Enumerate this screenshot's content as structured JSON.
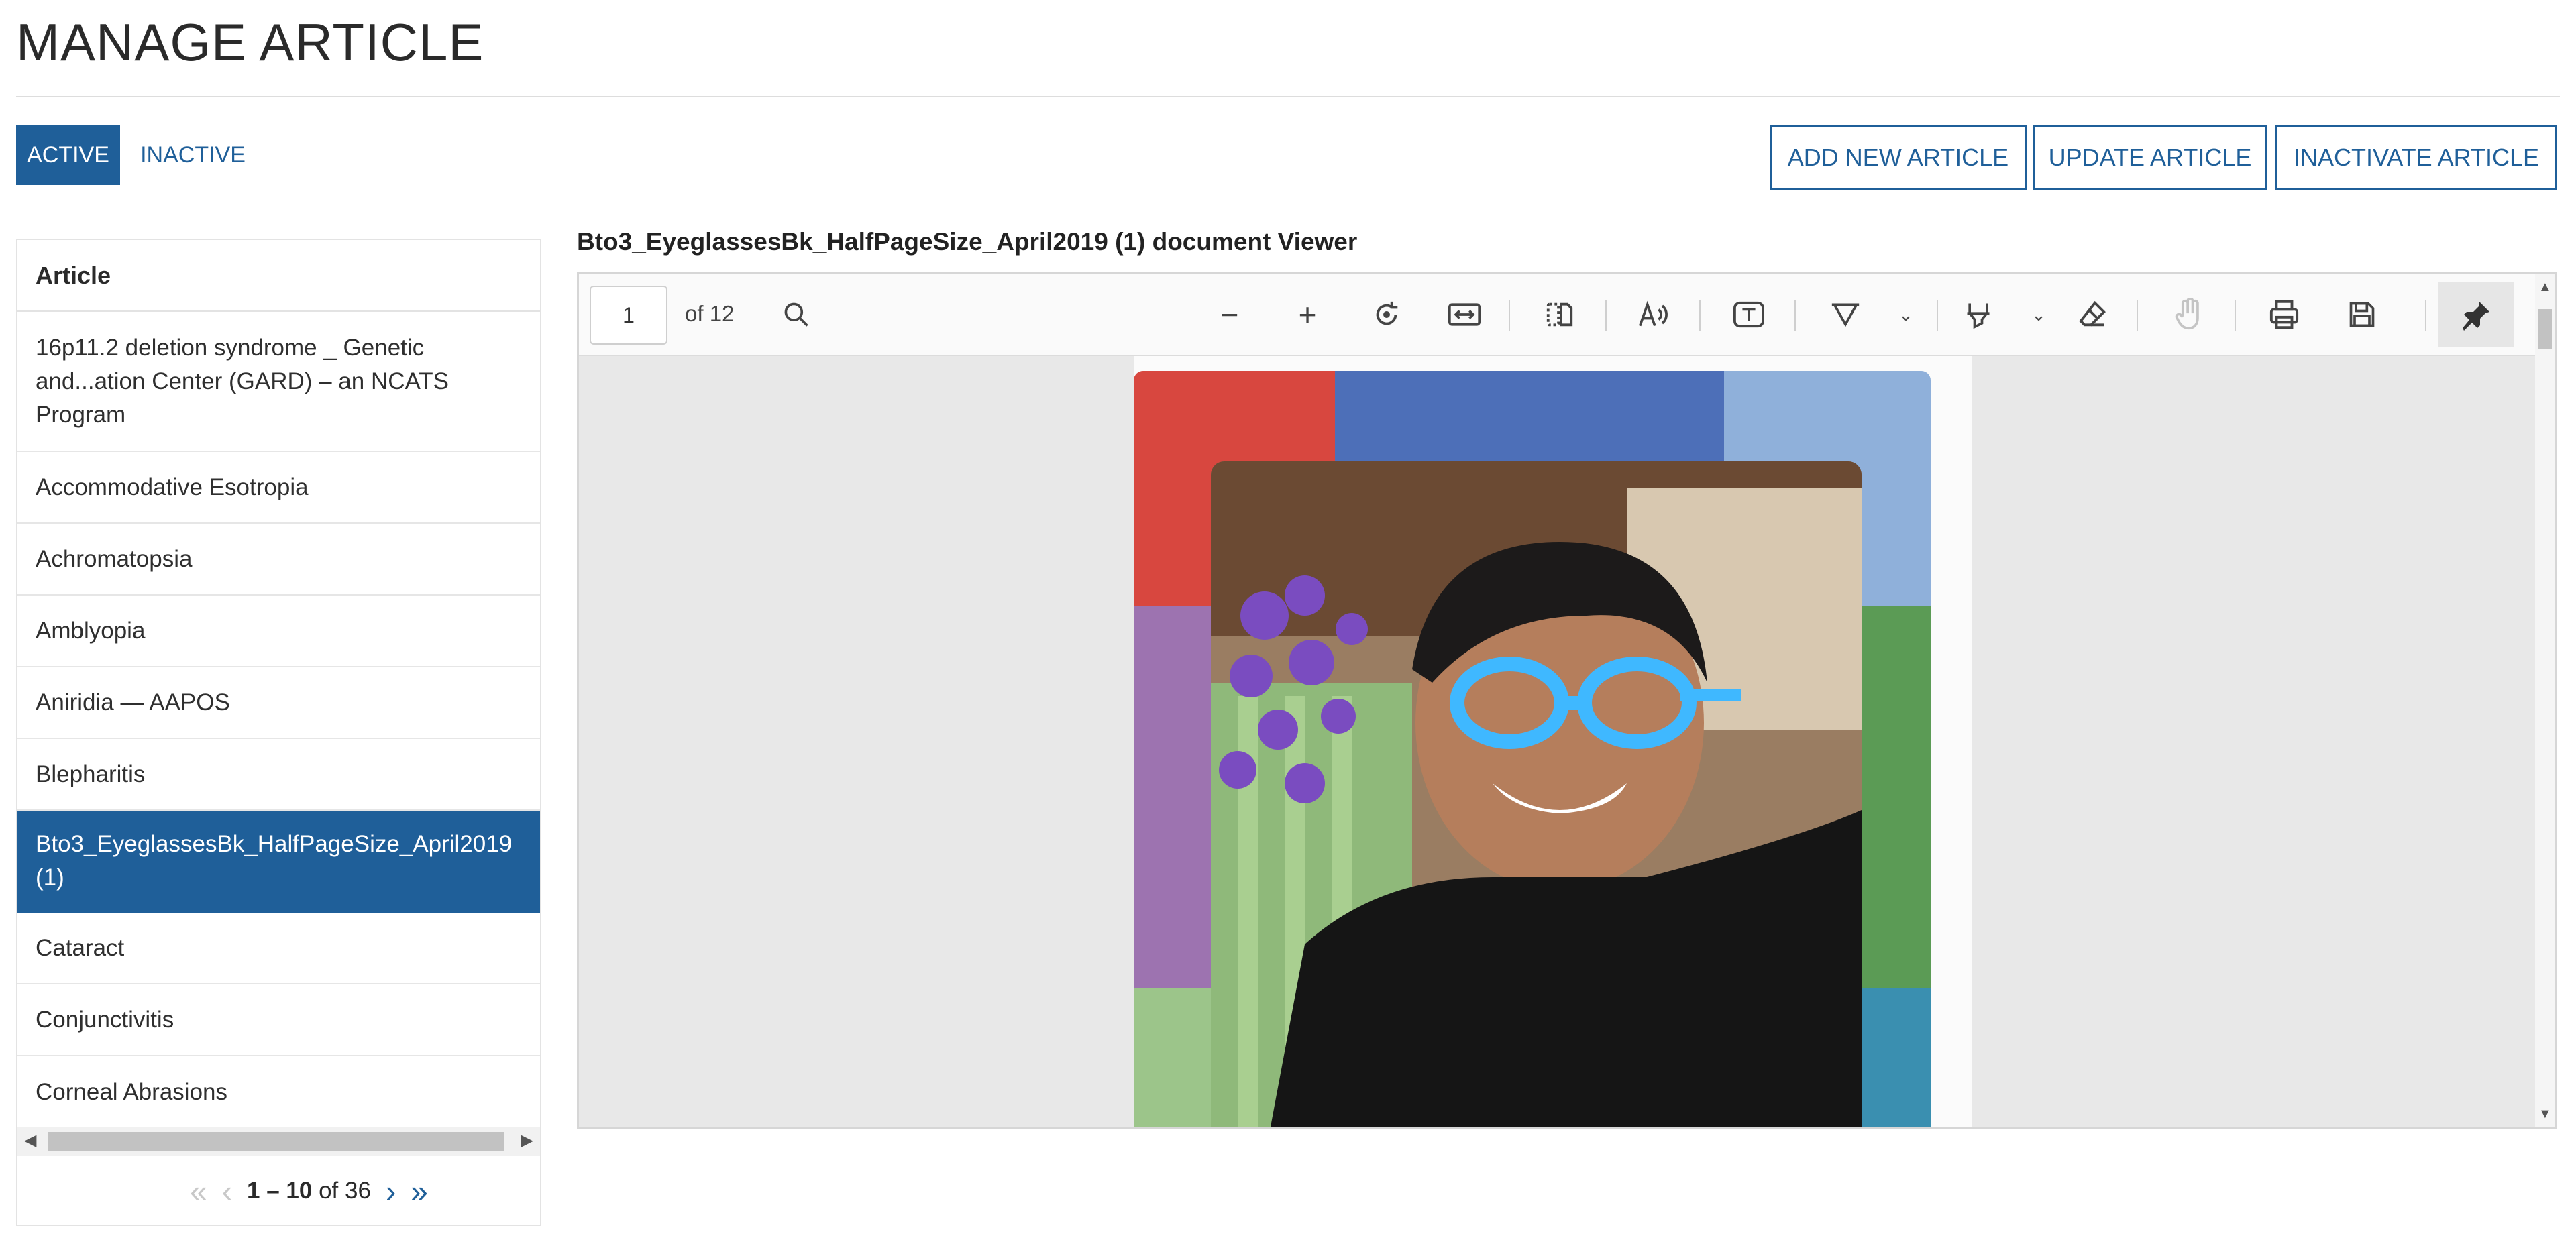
{
  "page": {
    "title": "MANAGE ARTICLE"
  },
  "status_tabs": {
    "active": "ACTIVE",
    "inactive": "INACTIVE"
  },
  "actions": {
    "add": "ADD NEW ARTICLE",
    "update": "UPDATE ARTICLE",
    "inactivate": "INACTIVATE ARTICLE"
  },
  "grid": {
    "header": "Article",
    "rows": [
      {
        "label": "16p11.2 deletion syndrome _ Genetic and...ation Center (GARD) – an NCATS Program"
      },
      {
        "label": "Accommodative Esotropia"
      },
      {
        "label": "Achromatopsia"
      },
      {
        "label": "Amblyopia"
      },
      {
        "label": "Aniridia — AAPOS"
      },
      {
        "label": "Blepharitis"
      },
      {
        "label": "Bto3_EyeglassesBk_HalfPageSize_April2019 (1)",
        "selected": true
      },
      {
        "label": "Cataract"
      },
      {
        "label": "Conjunctivitis"
      },
      {
        "label": "Corneal Abrasions"
      }
    ],
    "pager": {
      "range": "1 – 10",
      "of": "of",
      "total": "36"
    }
  },
  "viewer": {
    "title": "Bto3_EyeglassesBk_HalfPageSize_April2019 (1) document Viewer",
    "current_page": "1",
    "page_count": "of 12",
    "colors": {
      "red": "#d8473f",
      "blue": "#4d6fb8",
      "lightblue": "#8fb0da",
      "purple": "#9d73b0",
      "green": "#5b9b55",
      "lightgreen": "#9cc58a",
      "teal": "#3a8fb0"
    }
  }
}
